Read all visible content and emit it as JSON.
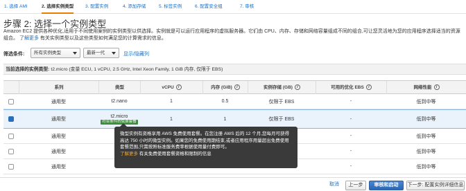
{
  "steps": [
    {
      "label": "1. 选择 AMI",
      "active": false
    },
    {
      "label": "2. 选择实例类型",
      "active": true
    },
    {
      "label": "3. 配置实例",
      "active": false
    },
    {
      "label": "4. 添加存储",
      "active": false
    },
    {
      "label": "5. 标签实例",
      "active": false
    },
    {
      "label": "6. 配置安全组",
      "active": false
    },
    {
      "label": "7. 审核",
      "active": false
    }
  ],
  "page": {
    "title": "步骤 2: 选择一个实例类型",
    "description": "Amazon EC2 提供各种优化,适用于不同使用案例的实例类型以供选择。实例就是可以运行应用程序的虚拟服务器。它们由 CPU、内存、存储和网络容量组成不同的组合,可让您灵活地为您的应用程序选择适当的资源组合。",
    "learn_more": "了解更多",
    "description_tail": " 有关实例类型以及这些类型如何满足您的计算需求的信息。"
  },
  "filter": {
    "label": "筛选条件:",
    "family_value": "所有实例类型",
    "generation_value": "最新一代",
    "toggle_columns": "显示/隐藏列"
  },
  "selection_bar": {
    "prefix": "当前选择的实例类型:",
    "value": "t2.micro (变量 ECU, 1 vCPU, 2.5 GHz, Intel Xeon Family, 1 GiB 内存, 仅限于 EBS)"
  },
  "table": {
    "columns": [
      "系列",
      "类型",
      "vCPU",
      "内存 (GiB)",
      "实例存储 (GB)",
      "可用的优化 EBS",
      "网络性能"
    ],
    "info_glyph": "i",
    "rows": [
      {
        "family": "通用型",
        "type": "t2.nano",
        "badge": "",
        "vcpu": "1",
        "memory": "0.5",
        "storage": "仅限于 EBS",
        "ebs": "-",
        "network": "低到中等",
        "selected": false
      },
      {
        "family": "通用型",
        "type": "t2.micro",
        "badge": "符合条件的免费套餐",
        "vcpu": "1",
        "memory": "1",
        "storage": "仅限于 EBS",
        "ebs": "-",
        "network": "低到中等",
        "selected": true
      },
      {
        "family": "通用型",
        "type": "",
        "badge": "",
        "vcpu": "",
        "memory": "",
        "storage": "",
        "ebs": "-",
        "network": "低到中等",
        "selected": false
      },
      {
        "family": "通用型",
        "type": "",
        "badge": "",
        "vcpu": "",
        "memory": "",
        "storage": "",
        "ebs": "-",
        "network": "低到中等",
        "selected": false
      },
      {
        "family": "通用型",
        "type": "t",
        "badge": "",
        "vcpu": "",
        "memory": "",
        "storage": "",
        "ebs": "-",
        "network": "低到中等",
        "selected": false
      }
    ]
  },
  "tooltip": {
    "text": "微型实例有资格享用 AWS 免费使用套餐。在您注册 AWS 后的 12 个月,您每月可获得高达 750 小时的微型实例。如果您的免费使用期结束,或者应用程序用量超出免费使用套餐范围,只需按照标准服务费率根据使用量付费即可。",
    "link": "了解更多",
    "tail": " 有关免费使用套餐资格和限制的信息"
  },
  "footer": {
    "cancel": "取消",
    "previous": "上一步",
    "review_launch": "审核和启动",
    "next": "下一步: 配置实例详细信息"
  }
}
